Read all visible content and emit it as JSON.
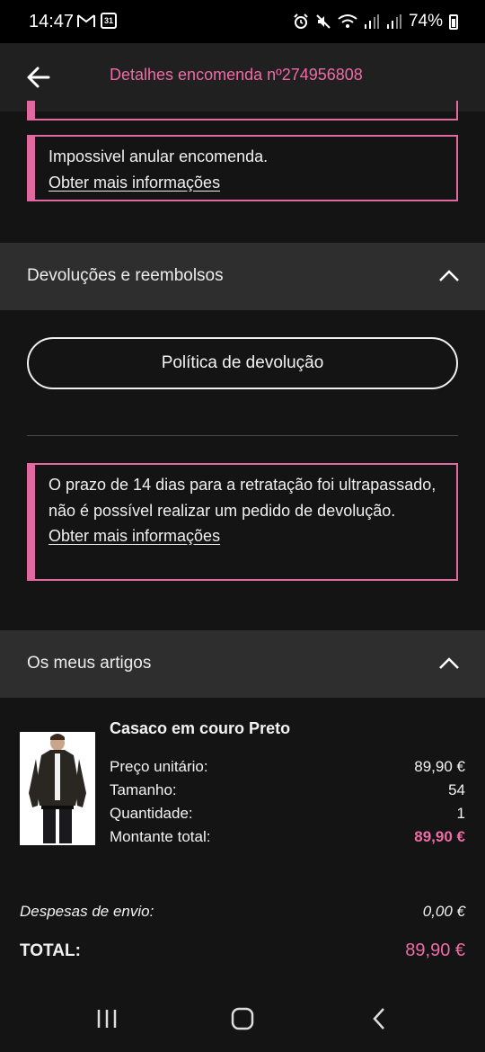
{
  "status_bar": {
    "time": "14:47",
    "calendar_day": "31",
    "battery": "74%"
  },
  "header": {
    "title": "Detalhes encomenda nº274956808"
  },
  "cancel_notice": {
    "text": "Impossivel anular encomenda.",
    "link": "Obter mais informações"
  },
  "returns_section": {
    "title": "Devoluções e reembolsos",
    "policy_button": "Política de devolução",
    "notice_text": "O prazo de 14 dias para a retratação foi ultrapassado, não é possível realizar um pedido de devolução.",
    "notice_link": "Obter mais informações"
  },
  "items_section": {
    "title": "Os meus artigos",
    "product": {
      "name": "Casaco em couro Preto",
      "rows": [
        {
          "label": "Preço unitário:",
          "value": "89,90 €"
        },
        {
          "label": "Tamanho:",
          "value": "54"
        },
        {
          "label": "Quantidade:",
          "value": "1"
        },
        {
          "label": "Montante total:",
          "value": "89,90 €"
        }
      ]
    }
  },
  "summary": {
    "shipping_label": "Despesas de envio:",
    "shipping_value": "0,00 €",
    "total_label": "TOTAL:",
    "total_value": "89,90 €"
  },
  "colors": {
    "accent": "#f06aa8",
    "box_border": "#e06aa0",
    "section_bg": "#2e2e2e",
    "page_bg": "#141414"
  }
}
